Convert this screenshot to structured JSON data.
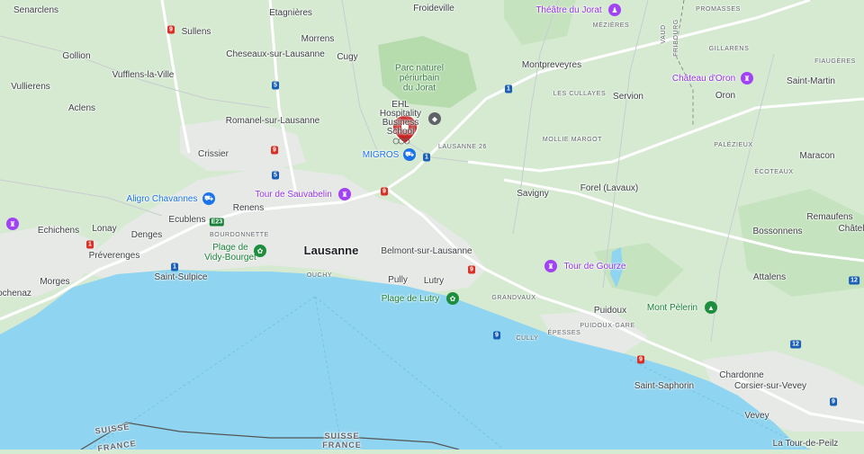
{
  "colors": {
    "land": "#d6ead2",
    "urban": "#e8ebe8",
    "water": "#8fd4f0",
    "forest": "#a8d5a0",
    "road_major": "#ffffff",
    "border": "#555555",
    "marker": "#c5221f"
  },
  "labels": {
    "senarclens": "Senarclens",
    "sullens": "Sullens",
    "etagnieres": "Etagnières",
    "froideville": "Froideville",
    "gollion": "Gollion",
    "morrens": "Morrens",
    "cheseaux": "Cheseaux-sur-Lausanne",
    "cugy": "Cugy",
    "vufflens": "Vufflens-la-Ville",
    "vullierens": "Vullierens",
    "aclens": "Aclens",
    "romanel": "Romanel-sur-Lausanne",
    "crissier": "Crissier",
    "renens": "Renens",
    "ecublens": "Ecublens",
    "echichens": "Echichens",
    "lonay": "Lonay",
    "denges": "Denges",
    "preverenges": "Préverenges",
    "morges": "Morges",
    "saint_sulpice": "Saint-Sulpice",
    "lausanne": "Lausanne",
    "belmont": "Belmont-sur-Lausanne",
    "pully": "Pully",
    "lutry": "Lutry",
    "montpreveyres": "Montpreveyres",
    "servion": "Servion",
    "oron": "Oron",
    "saint_martin": "Saint-Martin",
    "savigny": "Savigny",
    "forel": "Forel (Lavaux)",
    "maracon": "Maracon",
    "remaufens": "Remaufens",
    "chatel": "Châtel",
    "bossonnens": "Bossonnens",
    "attalens": "Attalens",
    "puidoux": "Puidoux",
    "chardonne": "Chardonne",
    "saint_saphorin": "Saint-Saphorin",
    "corsier": "Corsier-sur-Vevey",
    "vevey": "Vevey",
    "tour_de_peilz": "La Tour-de-Peilz",
    "ochenaz": "ochenaz",
    "bourdonnette": "BOURDONNETTE",
    "ouchy": "OUCHY",
    "mezieres": "MÉZIÈRES",
    "promasses": "PROMASSES",
    "gillarens": "GILLARENS",
    "fiaugeres": "FIAUGÈRES",
    "les_cullayes": "LES CULLAYES",
    "mollie_margot": "MOLLIE MARGOT",
    "palezieux": "PALÉZIEUX",
    "ecoteaux": "ÉCOTEAUX",
    "lausanne26": "LAUSANNE 26",
    "grandvaux": "GRANDVAUX",
    "cully": "CULLY",
    "epesses": "ÉPESSES",
    "puidoux_gare": "PUIDOUX-GARE",
    "vaud": "VAUD",
    "fribourg": "FRIBOURG",
    "suisse_left": "SUISSE",
    "france_left": "FRANCE",
    "suisse_center": "SUISSE",
    "france_center": "FRANCE",
    "park_line1": "Parc naturel",
    "park_line2": "périurbain",
    "park_line3": "du Jorat",
    "ehl_line1": "EHL",
    "ehl_line2": "Hospitality",
    "ehl_line3": "Business",
    "ehl_line4": "School",
    "theatre_jorat": "Théâtre du Jorat",
    "chateau_oron": "Château d'Oron",
    "migros": "MIGROS",
    "aligro": "Aligro Chavannes",
    "sauvabelin": "Tour de Sauvabelin",
    "plage_vidy_1": "Plage de",
    "plage_vidy_2": "Vidy-Bourget",
    "plage_lutry": "Plage de Lutry",
    "tour_gourze": "Tour de Gourze",
    "mont_pelerin": "Mont Pèlerin"
  },
  "road_shields": {
    "r9a": "9",
    "r5": "5",
    "r1a": "1",
    "r1b": "1",
    "r9b": "9",
    "r9c": "9",
    "r9d": "9",
    "r9e": "9",
    "r9f": "9",
    "r1c": "1",
    "r1d": "1",
    "r5b": "5",
    "r12a": "12",
    "r12b": "12",
    "e23": "E23",
    "r9g": "9"
  },
  "icons": {
    "marker": "location-pin-icon",
    "theatre": "theatre-icon",
    "castle": "landmark-icon",
    "shop": "shopping-cart-icon",
    "tower": "viewpoint-icon",
    "beach": "beach-icon",
    "mountain": "mountain-icon",
    "school": "school-icon"
  }
}
